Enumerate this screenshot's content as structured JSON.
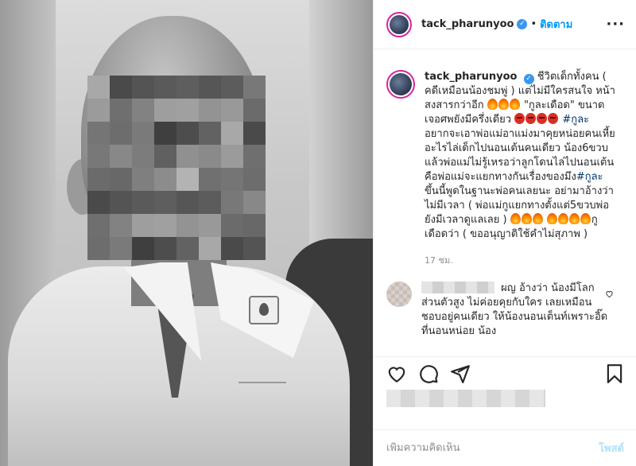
{
  "header": {
    "username": "tack_pharunyoo",
    "separator": "•",
    "follow_label": "ติดตาม",
    "more_label": "···"
  },
  "caption": {
    "username": "tack_pharunyoo",
    "part1": "ชีวิตเด็กทั้งคน ( คดีเหมือนน้องชมพู่ ) แต่ไม่มีใครสนใจ หน้าสงสารกว่าอีก",
    "part2": " \"กูละเดือด\" ขนาดเจอศพยังมีครึ่งเดียว",
    "hashtag1": "#กูละ",
    "part3": "อยากจะเอาพ่อแม่อาแม่งมาคุยหน่อยคนเหี้ยอะไรไล่เด็กไปนอนเต้นคนเดียว น้อง6ขวบแล้วพ่อแม่ไม่รู้เหรอว่าลูกโดนไล่ไปนอนเต้นคือพ่อแม่จะแยกทางกันเรื่องของมึง",
    "hashtag2": "#กูละ",
    "part4": "ขึ้นนี้พูดในฐานะพ่อคนเลยนะ อย่ามาอ้างว่าไม่มีเวลา ( พ่อแม่กูแยกทางตั้งแต่5ขวบพ่อยังมีเวลาดูแลเลย )",
    "part5": "กูเดือดว่า ( ขออนุญาติใช้คำไม่สุภาพ )",
    "time_ago": "17 ชม."
  },
  "comment": {
    "text": "ผญ อ้างว่า น้องมีโลกส่วนตัวสูง ไม่ค่อยคุยกับใคร เลยเหมือนชอบอยู่คนเดียว ให้น้องนอนเต็นท์เพราะอิ๊ดที่นอนหน่อย น้อง"
  },
  "actions": {
    "like_icon": "heart-icon",
    "comment_icon": "comment-icon",
    "share_icon": "share-icon",
    "save_icon": "bookmark-icon"
  },
  "comment_box": {
    "placeholder": "เพิ่มความคิดเห็น",
    "post_label": "โพสต์"
  },
  "colors": {
    "link": "#0095f6",
    "verified": "#3897f0",
    "hashtag": "#00376b",
    "muted": "#8e8e8e"
  }
}
